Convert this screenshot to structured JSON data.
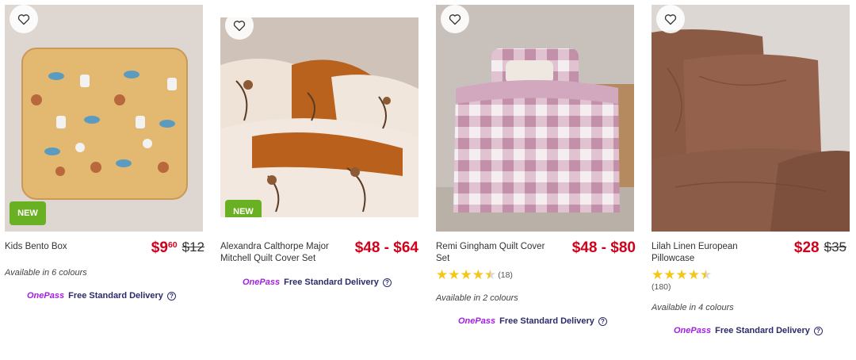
{
  "products": [
    {
      "name": "Kids Bento Box",
      "badge": "NEW",
      "price_main": "$9",
      "price_cents": "60",
      "price_was": "$12",
      "colours": "Available in 6 colours",
      "onepass": "OnePass",
      "delivery": "Free Standard Delivery"
    },
    {
      "name": "Alexandra Calthorpe Major Mitchell Quilt Cover Set",
      "badge": "NEW",
      "price_main": "$48 - $64",
      "onepass": "OnePass",
      "delivery": "Free Standard Delivery"
    },
    {
      "name": "Remi Gingham Quilt Cover Set",
      "price_main": "$48 - $80",
      "rating": 4.5,
      "rating_count": "(18)",
      "colours": "Available in 2 colours",
      "onepass": "OnePass",
      "delivery": "Free Standard Delivery"
    },
    {
      "name": "Lilah Linen European Pillowcase",
      "price_main": "$28",
      "price_was": "$35",
      "rating": 4.5,
      "rating_count": "(180)",
      "colours": "Available in 4 colours",
      "onepass": "OnePass",
      "delivery": "Free Standard Delivery"
    }
  ],
  "icons": {
    "wishlist": "heart-outline-icon",
    "help": "question-circle-icon",
    "star": "star-icon"
  },
  "colors": {
    "price_red": "#d0021b",
    "badge_green": "#6ab023",
    "onepass_purple": "#a320e0",
    "star_gold": "#f5c518"
  }
}
